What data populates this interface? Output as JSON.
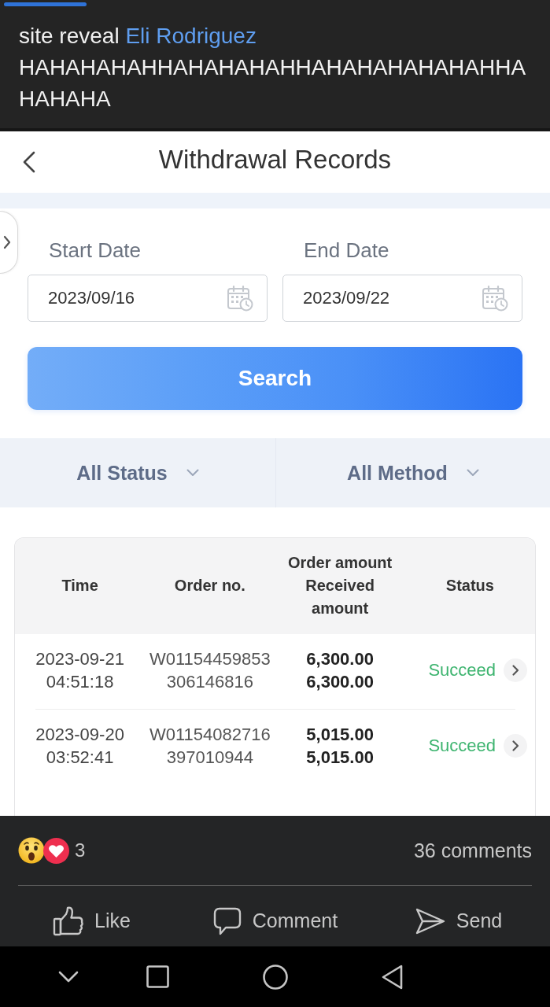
{
  "post": {
    "caption": {
      "prefix": "site reveal",
      "mention": "Eli Rodriguez",
      "text": "HAHAHAHAHHAHAHAHAHHAHAHAHAHAHAHHAHAHAHA"
    }
  },
  "screen": {
    "title": "Withdrawal Records",
    "date_form": {
      "fields": [
        {
          "label": "Start Date",
          "value": "2023/09/16"
        },
        {
          "label": "End Date",
          "value": "2023/09/22"
        }
      ],
      "search_button": "Search"
    },
    "filters": [
      {
        "label": "All Status"
      },
      {
        "label": "All Method"
      }
    ],
    "table": {
      "columns": [
        "Time",
        "Order no.",
        "Order amount Received amount",
        "Status"
      ],
      "rows": [
        {
          "time": "2023-09-21 04:51:18",
          "order_no": "W01154459853306146816",
          "order_amount": "6,300.00",
          "received_amount": "6,300.00",
          "status": "Succeed"
        },
        {
          "time": "2023-09-20 03:52:41",
          "order_no": "W01154082716397010944",
          "order_amount": "5,015.00",
          "received_amount": "5,015.00",
          "status": "Succeed"
        }
      ]
    }
  },
  "reactions": {
    "count": "3",
    "comments": "36 comments"
  },
  "actions": [
    {
      "kind": "like",
      "label": "Like"
    },
    {
      "kind": "comment",
      "label": "Comment"
    },
    {
      "kind": "send",
      "label": "Send"
    }
  ]
}
